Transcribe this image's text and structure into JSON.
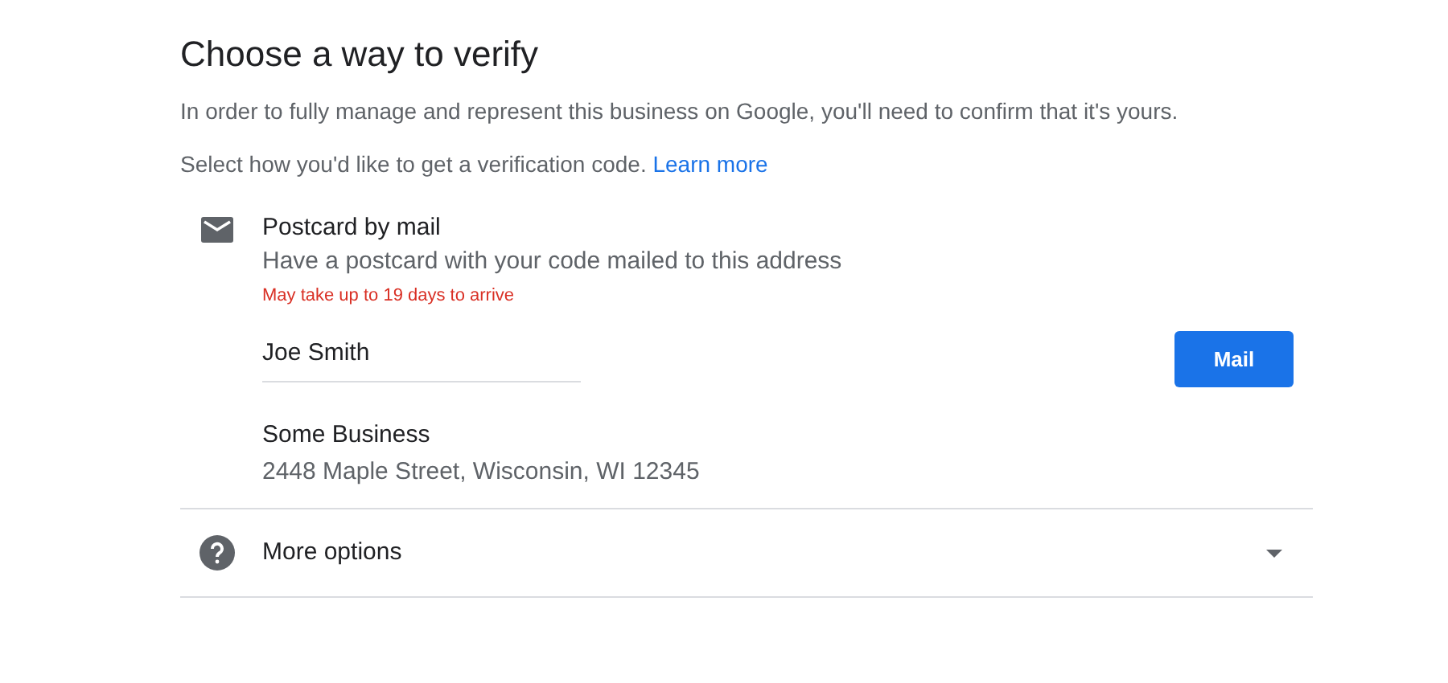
{
  "title": "Choose a way to verify",
  "intro": "In order to fully manage and represent this business on Google, you'll need to confirm that it's yours.",
  "prompt": {
    "text": "Select how you'd like to get a verification code.",
    "link": "Learn more"
  },
  "option": {
    "title": "Postcard by mail",
    "description": "Have a postcard with your code mailed to this address",
    "warning": "May take up to 19 days to arrive",
    "name_field": {
      "value": "Joe Smith"
    },
    "button": "Mail",
    "business_name": "Some Business",
    "address": "2448 Maple Street, Wisconsin, WI 12345"
  },
  "more_options": {
    "label": "More options",
    "expanded": false
  }
}
